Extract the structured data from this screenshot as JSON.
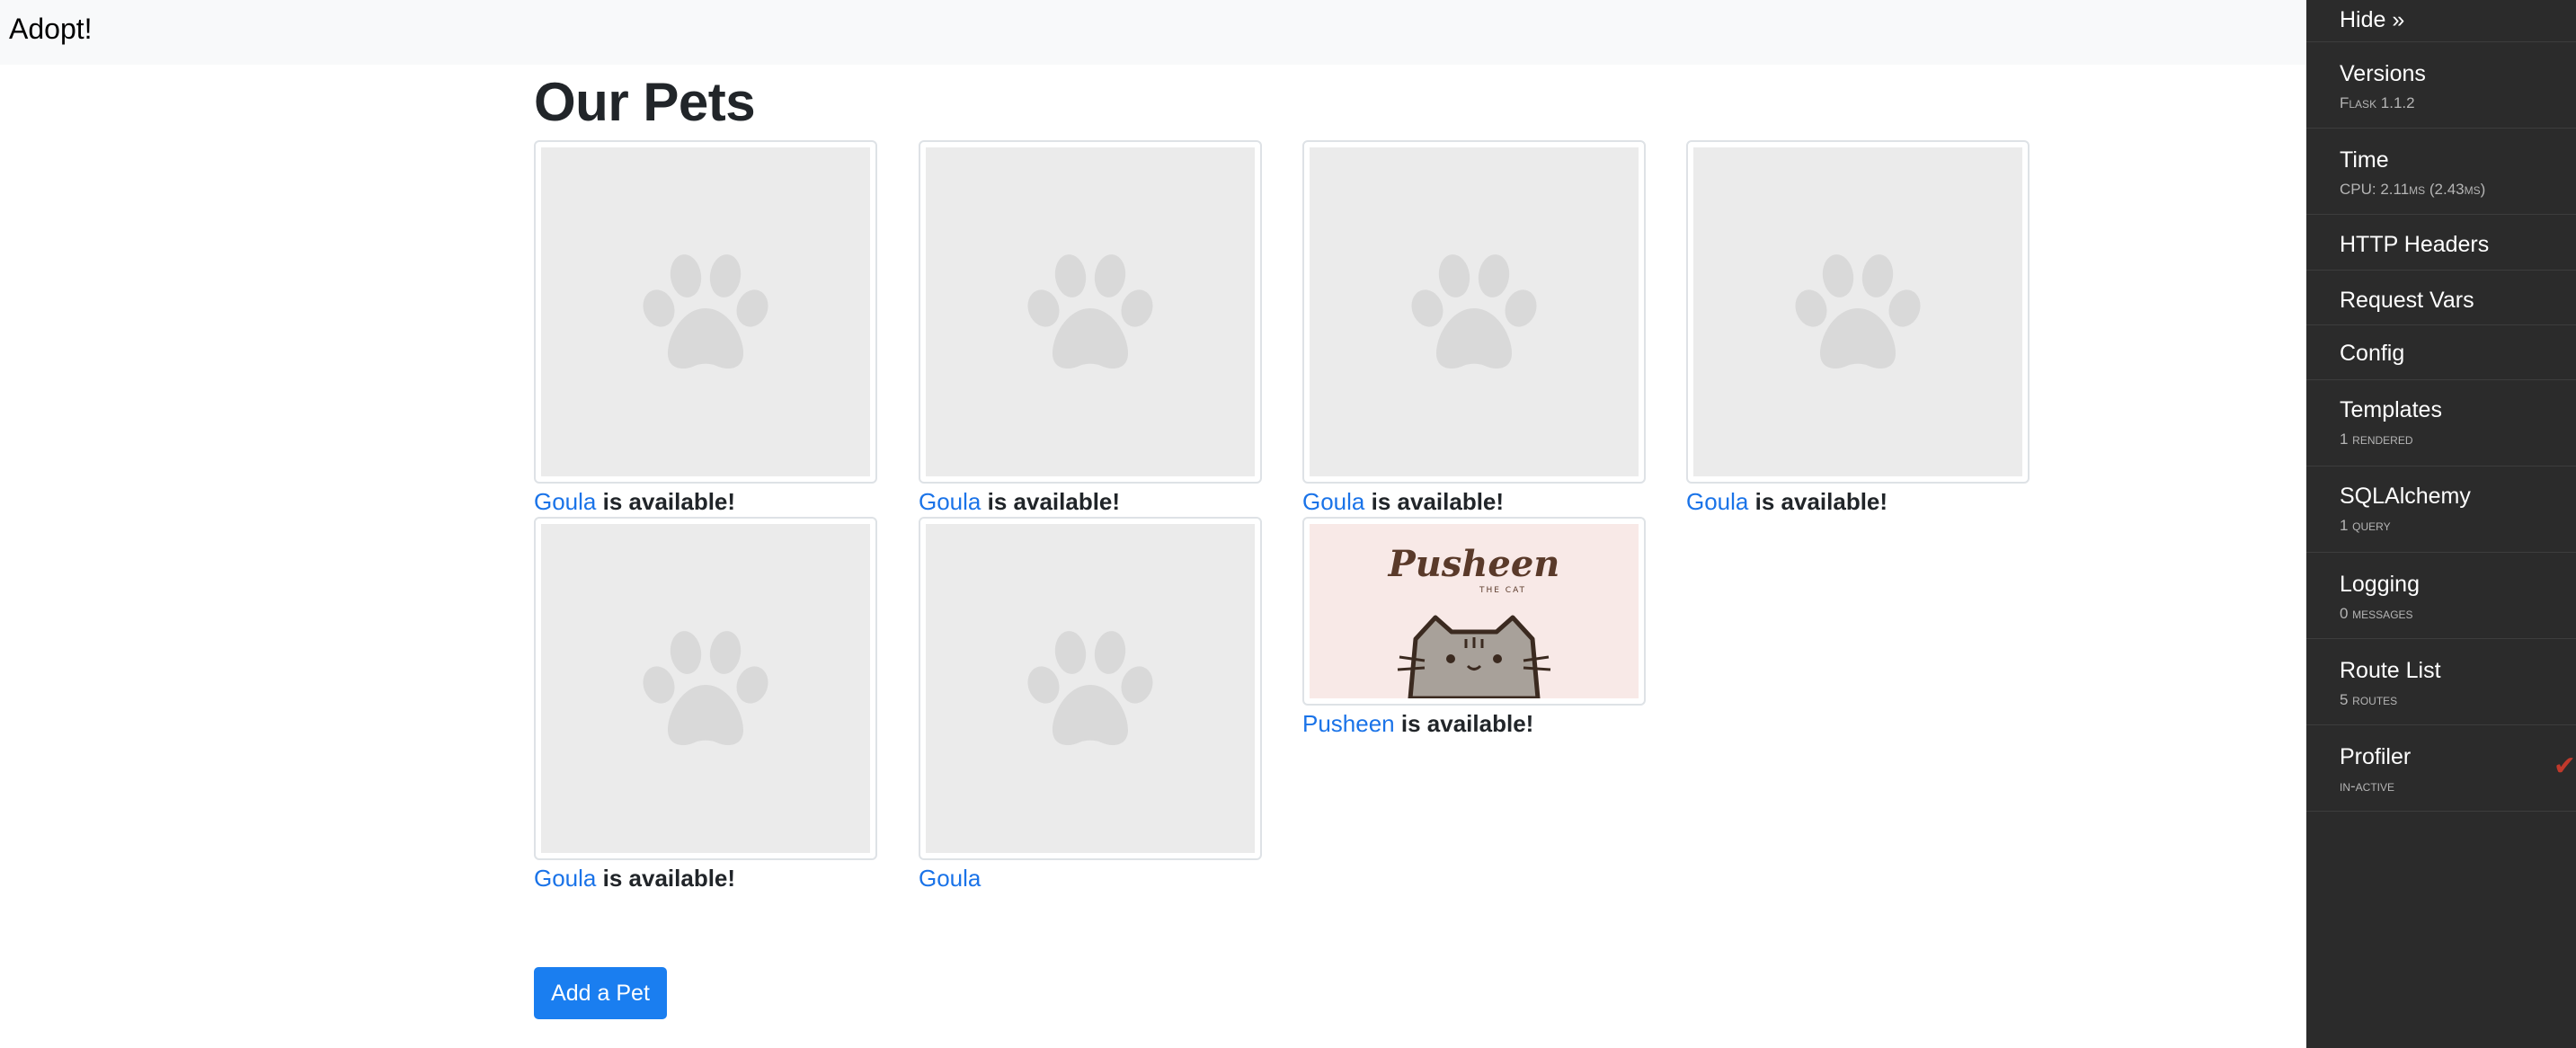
{
  "navbar": {
    "brand": "Adopt!"
  },
  "main": {
    "title": "Our Pets",
    "available_suffix": "is available!",
    "add_button": "Add a Pet",
    "pets": [
      {
        "name": "Goula",
        "available": true,
        "image": "paw-placeholder"
      },
      {
        "name": "Goula",
        "available": true,
        "image": "paw-placeholder"
      },
      {
        "name": "Goula",
        "available": true,
        "image": "paw-placeholder"
      },
      {
        "name": "Goula",
        "available": true,
        "image": "paw-placeholder"
      },
      {
        "name": "Goula",
        "available": true,
        "image": "paw-placeholder"
      },
      {
        "name": "Goula",
        "available": false,
        "image": "paw-placeholder"
      },
      {
        "name": "Pusheen",
        "available": true,
        "image": "pusheen-the-cat"
      }
    ],
    "pusheen_logo": "Pusheen",
    "pusheen_logo_sub": "THE CAT"
  },
  "toolbar": {
    "hide": "Hide »",
    "panels": [
      {
        "title": "Versions",
        "subtitle": "Flask 1.1.2"
      },
      {
        "title": "Time",
        "subtitle": "CPU: 2.11ms (2.43ms)"
      },
      {
        "title": "HTTP Headers",
        "subtitle": ""
      },
      {
        "title": "Request Vars",
        "subtitle": ""
      },
      {
        "title": "Config",
        "subtitle": ""
      },
      {
        "title": "Templates",
        "subtitle": "1 rendered"
      },
      {
        "title": "SQLAlchemy",
        "subtitle": "1 query"
      },
      {
        "title": "Logging",
        "subtitle": "0 messages"
      },
      {
        "title": "Route List",
        "subtitle": "5 routes"
      },
      {
        "title": "Profiler",
        "subtitle": "in-active",
        "checked": true
      }
    ]
  },
  "colors": {
    "link": "#1a73e8",
    "button": "#1a7ef0",
    "toolbar_bg": "#2b2b2b",
    "placeholder_bg": "#ebebeb",
    "check": "#c0392b"
  }
}
